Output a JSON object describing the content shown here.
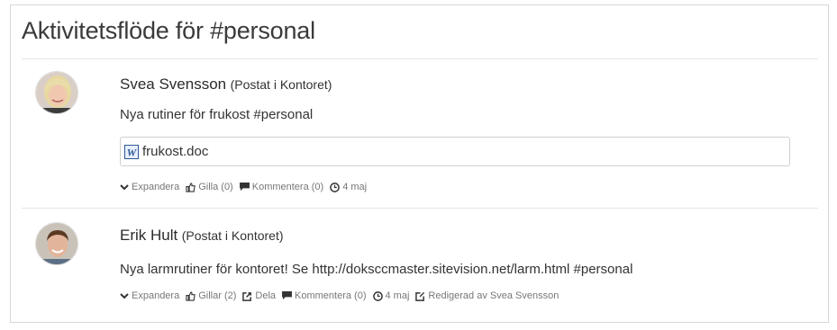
{
  "panel": {
    "title": "Aktivitetsflöde för #personal"
  },
  "entries": [
    {
      "author": "Svea Svensson",
      "posted_in": "(Postat i Kontoret)",
      "message": "Nya rutiner för frukost #personal",
      "attachment": {
        "name": "frukost.doc",
        "icon": "word-doc-icon"
      },
      "actions": {
        "expand": "Expandera",
        "like": "Gilla (0)",
        "comment": "Kommentera (0)",
        "date": "4 maj"
      }
    },
    {
      "author": "Erik Hult",
      "posted_in": "(Postat i Kontoret)",
      "message": "Nya larmrutiner för kontoret! Se http://doksccmaster.sitevision.net/larm.html #personal",
      "actions": {
        "expand": "Expandera",
        "like": "Gillar (2)",
        "share": "Dela",
        "comment": "Kommentera (0)",
        "date": "4 maj",
        "edited": "Redigerad av Svea Svensson"
      }
    }
  ]
}
